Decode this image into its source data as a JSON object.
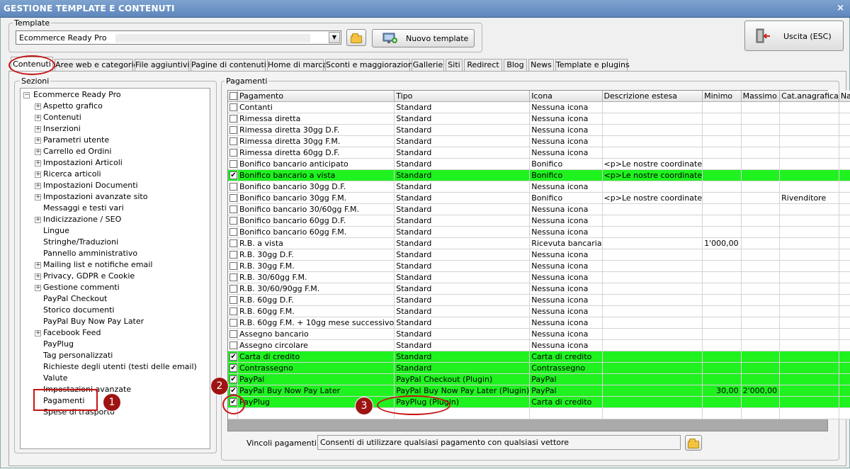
{
  "window": {
    "title": "GESTIONE TEMPLATE E CONTENUTI",
    "close_glyph": "×"
  },
  "template": {
    "legend": "Template",
    "selected": "Ecommerce Ready Pro",
    "new_button": "Nuovo template"
  },
  "exit_button": "Uscita (ESC)",
  "tabs": [
    "Contenuti",
    "Aree web e categorie",
    "File aggiuntivi",
    "Pagine di contenuti",
    "Home di marca",
    "Sconti e maggiorazioni",
    "Gallerie",
    "Siti",
    "Redirect",
    "Blog",
    "News",
    "Template e plugins"
  ],
  "sections": {
    "legend": "Sezioni",
    "root": "Ecommerce Ready Pro",
    "items": [
      {
        "label": "Aspetto grafico",
        "expandable": true
      },
      {
        "label": "Contenuti",
        "expandable": true
      },
      {
        "label": "Inserzioni",
        "expandable": true
      },
      {
        "label": "Parametri utente",
        "expandable": true
      },
      {
        "label": "Carrello ed Ordini",
        "expandable": true
      },
      {
        "label": "Impostazioni Articoli",
        "expandable": true
      },
      {
        "label": "Ricerca articoli",
        "expandable": true
      },
      {
        "label": "Impostazioni Documenti",
        "expandable": true
      },
      {
        "label": "Impostazioni avanzate sito",
        "expandable": true
      },
      {
        "label": "Messaggi e testi vari",
        "expandable": false
      },
      {
        "label": "Indicizzazione / SEO",
        "expandable": true
      },
      {
        "label": "Lingue",
        "expandable": false
      },
      {
        "label": "Stringhe/Traduzioni",
        "expandable": false
      },
      {
        "label": "Pannello amministrativo",
        "expandable": false
      },
      {
        "label": "Mailing list e notifiche email",
        "expandable": true
      },
      {
        "label": "Privacy, GDPR e Cookie",
        "expandable": true
      },
      {
        "label": "Gestione commenti",
        "expandable": true
      },
      {
        "label": "PayPal Checkout",
        "expandable": false
      },
      {
        "label": "Storico documenti",
        "expandable": false
      },
      {
        "label": "PayPal Buy Now Pay Later",
        "expandable": false
      },
      {
        "label": "Facebook Feed",
        "expandable": true
      },
      {
        "label": "PayPlug",
        "expandable": false
      },
      {
        "label": "Tag personalizzati",
        "expandable": false
      },
      {
        "label": "Richieste degli utenti (testi delle email)",
        "expandable": false
      },
      {
        "label": "Valute",
        "expandable": false
      },
      {
        "label": "Impostazioni avanzate",
        "expandable": false
      },
      {
        "label": "Pagamenti",
        "expandable": false
      },
      {
        "label": "Spese di trasporto",
        "expandable": false
      }
    ]
  },
  "payments": {
    "legend": "Pagamenti",
    "columns": [
      "Pagamento",
      "Tipo",
      "Icona",
      "Descrizione estesa",
      "Minimo",
      "Massimo",
      "Cat.anagrafica",
      "Nazione"
    ],
    "rows": [
      {
        "checked": false,
        "highlight": false,
        "cells": [
          "Contanti",
          "Standard",
          "Nessuna icona",
          "",
          "",
          "",
          "",
          ""
        ]
      },
      {
        "checked": false,
        "highlight": false,
        "cells": [
          "Rimessa diretta",
          "Standard",
          "Nessuna icona",
          "",
          "",
          "",
          "",
          ""
        ]
      },
      {
        "checked": false,
        "highlight": false,
        "cells": [
          "Rimessa diretta 30gg D.F.",
          "Standard",
          "Nessuna icona",
          "",
          "",
          "",
          "",
          ""
        ]
      },
      {
        "checked": false,
        "highlight": false,
        "cells": [
          "Rimessa diretta 30gg F.M.",
          "Standard",
          "Nessuna icona",
          "",
          "",
          "",
          "",
          ""
        ]
      },
      {
        "checked": false,
        "highlight": false,
        "cells": [
          "Rimessa diretta 60gg D.F.",
          "Standard",
          "Nessuna icona",
          "",
          "",
          "",
          "",
          ""
        ]
      },
      {
        "checked": false,
        "highlight": false,
        "cells": [
          "Bonifico bancario anticipato",
          "Standard",
          "Bonifico",
          "<p>Le nostre coordinate",
          "",
          "",
          "",
          ""
        ]
      },
      {
        "checked": true,
        "highlight": true,
        "cells": [
          "Bonifico bancario a vista",
          "Standard",
          "Bonifico",
          "<p>Le nostre coordinate",
          "",
          "",
          "",
          ""
        ]
      },
      {
        "checked": false,
        "highlight": false,
        "cells": [
          "Bonifico bancario 30gg D.F.",
          "Standard",
          "Nessuna icona",
          "",
          "",
          "",
          "",
          ""
        ]
      },
      {
        "checked": false,
        "highlight": false,
        "cells": [
          "Bonifico bancario 30gg F.M.",
          "Standard",
          "Bonifico",
          "<p>Le nostre coordinate",
          "",
          "",
          "Rivenditore",
          ""
        ]
      },
      {
        "checked": false,
        "highlight": false,
        "cells": [
          "Bonifico bancario 30/60gg F.M.",
          "Standard",
          "Nessuna icona",
          "",
          "",
          "",
          "",
          ""
        ]
      },
      {
        "checked": false,
        "highlight": false,
        "cells": [
          "Bonifico bancario 60gg D.F.",
          "Standard",
          "Nessuna icona",
          "",
          "",
          "",
          "",
          ""
        ]
      },
      {
        "checked": false,
        "highlight": false,
        "cells": [
          "Bonifico bancario 60gg F.M.",
          "Standard",
          "Nessuna icona",
          "",
          "",
          "",
          "",
          ""
        ]
      },
      {
        "checked": false,
        "highlight": false,
        "cells": [
          "R.B. a vista",
          "Standard",
          "Ricevuta bancaria",
          "",
          "1'000,00",
          "",
          "",
          ""
        ]
      },
      {
        "checked": false,
        "highlight": false,
        "cells": [
          "R.B. 30gg D.F.",
          "Standard",
          "Nessuna icona",
          "",
          "",
          "",
          "",
          ""
        ]
      },
      {
        "checked": false,
        "highlight": false,
        "cells": [
          "R.B. 30gg F.M.",
          "Standard",
          "Nessuna icona",
          "",
          "",
          "",
          "",
          ""
        ]
      },
      {
        "checked": false,
        "highlight": false,
        "cells": [
          "R.B. 30/60gg F.M.",
          "Standard",
          "Nessuna icona",
          "",
          "",
          "",
          "",
          ""
        ]
      },
      {
        "checked": false,
        "highlight": false,
        "cells": [
          "R.B. 30/60/90gg F.M.",
          "Standard",
          "Nessuna icona",
          "",
          "",
          "",
          "",
          ""
        ]
      },
      {
        "checked": false,
        "highlight": false,
        "cells": [
          "R.B. 60gg D.F.",
          "Standard",
          "Nessuna icona",
          "",
          "",
          "",
          "",
          ""
        ]
      },
      {
        "checked": false,
        "highlight": false,
        "cells": [
          "R.B. 60gg F.M.",
          "Standard",
          "Nessuna icona",
          "",
          "",
          "",
          "",
          ""
        ]
      },
      {
        "checked": false,
        "highlight": false,
        "cells": [
          "R.B. 60gg F.M. + 10gg mese successivo",
          "Standard",
          "Nessuna icona",
          "",
          "",
          "",
          "",
          ""
        ]
      },
      {
        "checked": false,
        "highlight": false,
        "cells": [
          "Assegno bancario",
          "Standard",
          "Nessuna icona",
          "",
          "",
          "",
          "",
          ""
        ]
      },
      {
        "checked": false,
        "highlight": false,
        "cells": [
          "Assegno circolare",
          "Standard",
          "Nessuna icona",
          "",
          "",
          "",
          "",
          ""
        ]
      },
      {
        "checked": true,
        "highlight": true,
        "cells": [
          "Carta di credito",
          "Standard",
          "Carta di credito",
          "",
          "",
          "",
          "",
          ""
        ]
      },
      {
        "checked": true,
        "highlight": true,
        "cells": [
          "Contrassegno",
          "Standard",
          "Contrassegno",
          "",
          "",
          "",
          "",
          ""
        ]
      },
      {
        "checked": true,
        "highlight": true,
        "cells": [
          "PayPal",
          "PayPal Checkout (Plugin)",
          "PayPal",
          "",
          "",
          "",
          "",
          ""
        ]
      },
      {
        "checked": true,
        "highlight": true,
        "cells": [
          "PayPal Buy Now Pay Later",
          "PayPal Buy Now Pay Later (Plugin)",
          "PayPal",
          "",
          "30,00",
          "2'000,00",
          "",
          ""
        ]
      },
      {
        "checked": true,
        "highlight": true,
        "cells": [
          "PayPlug",
          "PayPlug (Plugin)",
          "Carta di credito",
          "",
          "",
          "",
          "",
          ""
        ]
      }
    ],
    "check_mark": "✔",
    "constraints_label": "Vincoli pagamenti :",
    "constraints_value": "Consenti di utilizzare qualsiasi pagamento con qualsiasi vettore"
  },
  "annotations": {
    "marker_1": "1",
    "marker_2": "2",
    "marker_3": "3"
  },
  "colors": {
    "highlight_row": "#1ff21f",
    "annotation_red": "#c81414",
    "marker_fill": "#9e1412",
    "title_bar": "#6a91c6"
  }
}
